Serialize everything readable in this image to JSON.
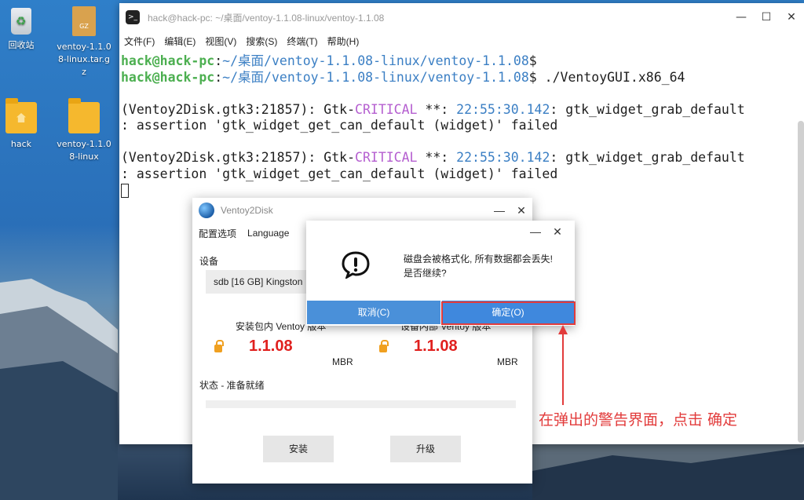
{
  "desktop": {
    "icons": [
      {
        "label": "回收站"
      },
      {
        "label": "ventoy-1.1.08-linux.tar.gz",
        "badge": "GZ"
      },
      {
        "label": "hack"
      },
      {
        "label": "ventoy-1.1.08-linux"
      }
    ]
  },
  "terminal": {
    "title": "hack@hack-pc: ~/桌面/ventoy-1.1.08-linux/ventoy-1.1.08",
    "menu": [
      "文件(F)",
      "编辑(E)",
      "视图(V)",
      "搜索(S)",
      "终端(T)",
      "帮助(H)"
    ],
    "prompt_user": "hack@hack-pc",
    "prompt_path": "~/桌面/ventoy-1.1.08-linux/ventoy-1.1.08",
    "command": " ./VentoyGUI.x86_64",
    "err_prefix": "(Ventoy2Disk.gtk3:21857): Gtk-",
    "err_level": "CRITICAL",
    "err_mid": " **: ",
    "err_time": "22:55:30.142",
    "err_func": ": gtk_widget_grab_default",
    "err_line2": ": assertion 'gtk_widget_get_can_default (widget)' failed"
  },
  "ventoy": {
    "title": "Ventoy2Disk",
    "menu": [
      "配置选项",
      "Language"
    ],
    "device_label": "设备",
    "device_value": "sdb  [16 GB]  Kingston",
    "pkg_version_label": "安装包内 Ventoy 版本",
    "dev_version_label": "设备内部 Ventoy 版本",
    "pkg_version": "1.1.08",
    "dev_version": "1.1.08",
    "pkg_scheme": "MBR",
    "dev_scheme": "MBR",
    "status": "状态 - 准备就绪",
    "install_button": "安装",
    "upgrade_button": "升级"
  },
  "dialog": {
    "message_line1": "磁盘会被格式化, 所有数据都会丢失!",
    "message_line2": "是否继续?",
    "cancel_button": "取消(C)",
    "ok_button": "确定(O)"
  },
  "annotation": {
    "text": "在弹出的警告界面，点击 确定",
    "color": "#e23b3b"
  }
}
